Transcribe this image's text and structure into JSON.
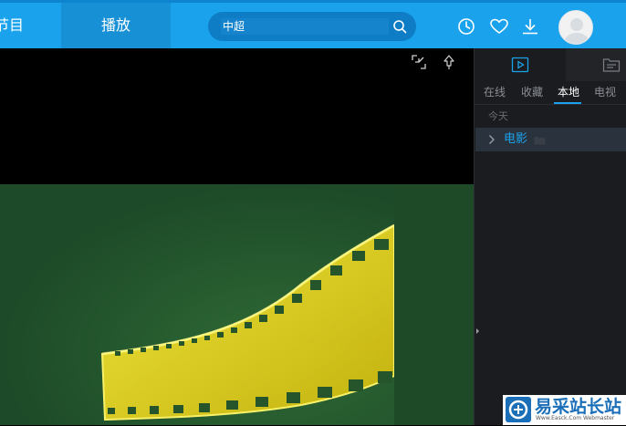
{
  "nav": {
    "left_item": "节目",
    "play_item": "播放"
  },
  "search": {
    "value": "中超"
  },
  "top_icons": [
    "history-icon",
    "favorite-heart-icon",
    "download-icon",
    "avatar"
  ],
  "player": {
    "controls": [
      "shrink-window-icon",
      "pin-icon"
    ]
  },
  "panel": {
    "head_icons": [
      "playlist-icon",
      "file-list-icon"
    ],
    "tabs": [
      {
        "label": "在线",
        "active": false
      },
      {
        "label": "收藏",
        "active": false
      },
      {
        "label": "本地",
        "active": true
      },
      {
        "label": "电视",
        "active": false
      }
    ],
    "date_label": "今天",
    "folder": {
      "name": "电影"
    }
  },
  "watermark": {
    "title": "易采站长站",
    "subtitle": "Www.Easck.Com Webmaster"
  },
  "colors": {
    "topbar": "#1aa3ec",
    "accent": "#1aa3ec",
    "panel_bg": "#1b1c1f",
    "video_bg": "#1f4f2a",
    "film": "#e8d81a"
  }
}
